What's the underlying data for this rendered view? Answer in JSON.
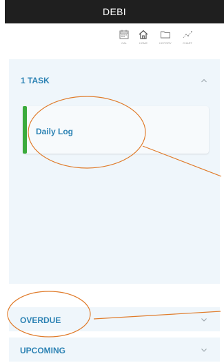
{
  "app": {
    "title": "DEBI"
  },
  "nav": {
    "items": [
      {
        "label": "CAL",
        "icon": "calendar-icon"
      },
      {
        "label": "HOME",
        "icon": "home-icon"
      },
      {
        "label": "HISTORY",
        "icon": "folder-icon"
      },
      {
        "label": "CHART",
        "icon": "chart-icon"
      }
    ]
  },
  "tasks": {
    "header": "1 TASK",
    "expanded": true,
    "items": [
      {
        "title": "Daily Log",
        "accent_color": "#3bab3c"
      }
    ]
  },
  "sections": {
    "overdue": "OVERDUE",
    "upcoming": "UPCOMING"
  },
  "colors": {
    "accent": "#2d83b4",
    "panel_bg": "#eff6fb",
    "titlebar_bg": "#1f1f1f",
    "annotation": "#e07b2a"
  }
}
